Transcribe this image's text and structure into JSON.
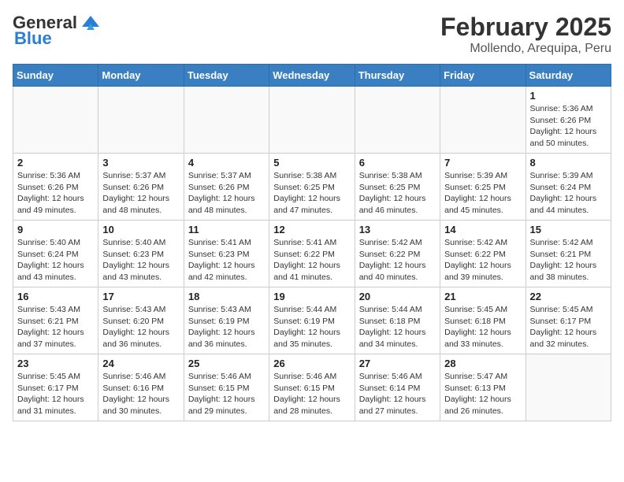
{
  "logo": {
    "general": "General",
    "blue": "Blue"
  },
  "title": "February 2025",
  "location": "Mollendo, Arequipa, Peru",
  "weekdays": [
    "Sunday",
    "Monday",
    "Tuesday",
    "Wednesday",
    "Thursday",
    "Friday",
    "Saturday"
  ],
  "weeks": [
    [
      {
        "day": "",
        "info": ""
      },
      {
        "day": "",
        "info": ""
      },
      {
        "day": "",
        "info": ""
      },
      {
        "day": "",
        "info": ""
      },
      {
        "day": "",
        "info": ""
      },
      {
        "day": "",
        "info": ""
      },
      {
        "day": "1",
        "info": "Sunrise: 5:36 AM\nSunset: 6:26 PM\nDaylight: 12 hours and 50 minutes."
      }
    ],
    [
      {
        "day": "2",
        "info": "Sunrise: 5:36 AM\nSunset: 6:26 PM\nDaylight: 12 hours and 49 minutes."
      },
      {
        "day": "3",
        "info": "Sunrise: 5:37 AM\nSunset: 6:26 PM\nDaylight: 12 hours and 48 minutes."
      },
      {
        "day": "4",
        "info": "Sunrise: 5:37 AM\nSunset: 6:26 PM\nDaylight: 12 hours and 48 minutes."
      },
      {
        "day": "5",
        "info": "Sunrise: 5:38 AM\nSunset: 6:25 PM\nDaylight: 12 hours and 47 minutes."
      },
      {
        "day": "6",
        "info": "Sunrise: 5:38 AM\nSunset: 6:25 PM\nDaylight: 12 hours and 46 minutes."
      },
      {
        "day": "7",
        "info": "Sunrise: 5:39 AM\nSunset: 6:25 PM\nDaylight: 12 hours and 45 minutes."
      },
      {
        "day": "8",
        "info": "Sunrise: 5:39 AM\nSunset: 6:24 PM\nDaylight: 12 hours and 44 minutes."
      }
    ],
    [
      {
        "day": "9",
        "info": "Sunrise: 5:40 AM\nSunset: 6:24 PM\nDaylight: 12 hours and 43 minutes."
      },
      {
        "day": "10",
        "info": "Sunrise: 5:40 AM\nSunset: 6:23 PM\nDaylight: 12 hours and 43 minutes."
      },
      {
        "day": "11",
        "info": "Sunrise: 5:41 AM\nSunset: 6:23 PM\nDaylight: 12 hours and 42 minutes."
      },
      {
        "day": "12",
        "info": "Sunrise: 5:41 AM\nSunset: 6:22 PM\nDaylight: 12 hours and 41 minutes."
      },
      {
        "day": "13",
        "info": "Sunrise: 5:42 AM\nSunset: 6:22 PM\nDaylight: 12 hours and 40 minutes."
      },
      {
        "day": "14",
        "info": "Sunrise: 5:42 AM\nSunset: 6:22 PM\nDaylight: 12 hours and 39 minutes."
      },
      {
        "day": "15",
        "info": "Sunrise: 5:42 AM\nSunset: 6:21 PM\nDaylight: 12 hours and 38 minutes."
      }
    ],
    [
      {
        "day": "16",
        "info": "Sunrise: 5:43 AM\nSunset: 6:21 PM\nDaylight: 12 hours and 37 minutes."
      },
      {
        "day": "17",
        "info": "Sunrise: 5:43 AM\nSunset: 6:20 PM\nDaylight: 12 hours and 36 minutes."
      },
      {
        "day": "18",
        "info": "Sunrise: 5:43 AM\nSunset: 6:19 PM\nDaylight: 12 hours and 36 minutes."
      },
      {
        "day": "19",
        "info": "Sunrise: 5:44 AM\nSunset: 6:19 PM\nDaylight: 12 hours and 35 minutes."
      },
      {
        "day": "20",
        "info": "Sunrise: 5:44 AM\nSunset: 6:18 PM\nDaylight: 12 hours and 34 minutes."
      },
      {
        "day": "21",
        "info": "Sunrise: 5:45 AM\nSunset: 6:18 PM\nDaylight: 12 hours and 33 minutes."
      },
      {
        "day": "22",
        "info": "Sunrise: 5:45 AM\nSunset: 6:17 PM\nDaylight: 12 hours and 32 minutes."
      }
    ],
    [
      {
        "day": "23",
        "info": "Sunrise: 5:45 AM\nSunset: 6:17 PM\nDaylight: 12 hours and 31 minutes."
      },
      {
        "day": "24",
        "info": "Sunrise: 5:46 AM\nSunset: 6:16 PM\nDaylight: 12 hours and 30 minutes."
      },
      {
        "day": "25",
        "info": "Sunrise: 5:46 AM\nSunset: 6:15 PM\nDaylight: 12 hours and 29 minutes."
      },
      {
        "day": "26",
        "info": "Sunrise: 5:46 AM\nSunset: 6:15 PM\nDaylight: 12 hours and 28 minutes."
      },
      {
        "day": "27",
        "info": "Sunrise: 5:46 AM\nSunset: 6:14 PM\nDaylight: 12 hours and 27 minutes."
      },
      {
        "day": "28",
        "info": "Sunrise: 5:47 AM\nSunset: 6:13 PM\nDaylight: 12 hours and 26 minutes."
      },
      {
        "day": "",
        "info": ""
      }
    ]
  ]
}
